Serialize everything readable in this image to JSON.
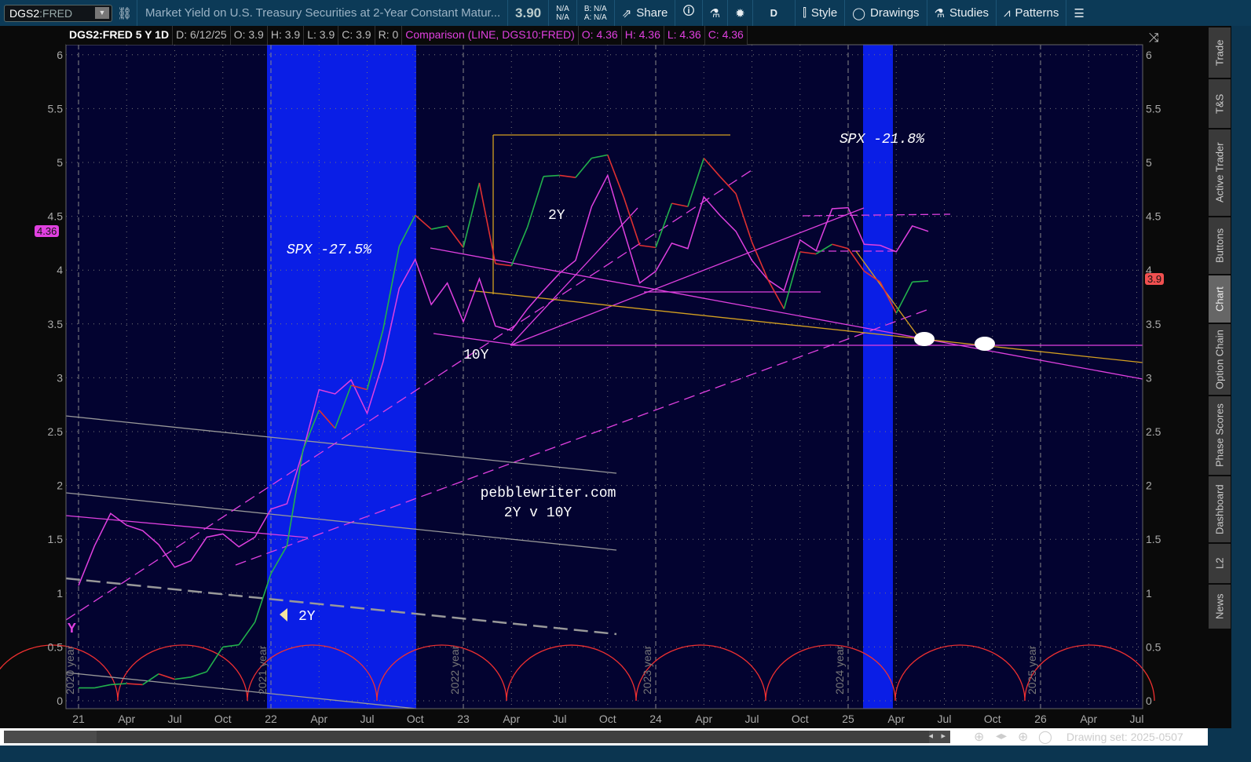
{
  "toolbar": {
    "symbol": "DGS2",
    "symbol_suffix": ":FRED",
    "description": "Market Yield on U.S. Treasury Securities at 2-Year Constant Matur...",
    "last": "3.90",
    "bidask_left": [
      "N/A",
      "N/A"
    ],
    "bid": "B: N/A",
    "ask": "A: N/A",
    "share": "Share",
    "period": "D",
    "style": "Style",
    "drawings": "Drawings",
    "studies": "Studies",
    "patterns": "Patterns"
  },
  "infobar": {
    "title": "DGS2:FRED 5 Y 1D",
    "date": "D: 6/12/25",
    "open": "O: 3.9",
    "high": "H: 3.9",
    "low": "L: 3.9",
    "close": "C: 3.9",
    "range": "R: 0",
    "comparison": "Comparison (LINE, DGS10:FRED)",
    "c_open": "O: 4.36",
    "c_high": "H: 4.36",
    "c_low": "L: 4.36",
    "c_close": "C: 4.36"
  },
  "bubbles": {
    "comparison": "4.36",
    "last": "3.9"
  },
  "colors": {
    "accent": "#e040e0",
    "up": "#22b14c",
    "down": "#e03030",
    "shade": "#0a1ee6",
    "bg": "#030330"
  },
  "annotations": {
    "spx1": "SPX -27.5%",
    "spx2": "SPX -21.8%",
    "lbl2y": "2Y",
    "lbl10y": "10Y",
    "site": "pebblewriter.com",
    "sub": "2Y v 10Y",
    "arrow2y": "2Y",
    "ylab": "Y"
  },
  "year_markers": [
    "2020 year",
    "2021 year",
    "2022 year",
    "2023 year",
    "2024 year",
    "2025 year"
  ],
  "side_tabs": [
    "Trade",
    "T&S",
    "Active Trader",
    "Buttons",
    "Chart",
    "Option Chain",
    "Phase Scores",
    "Dashboard",
    "L2",
    "News"
  ],
  "bottom": {
    "drawing_set": "Drawing set: 2025-0507"
  },
  "chart_data": {
    "type": "line",
    "title": "DGS2:FRED 5 Y 1D",
    "ylim": [
      0,
      6
    ],
    "yticks": [
      "0",
      "0.5",
      "1",
      "1.5",
      "2",
      "2.5",
      "3",
      "3.5",
      "4",
      "4.5",
      "5",
      "5.5",
      "6"
    ],
    "xticks": [
      "21",
      "Apr",
      "Jul",
      "Oct",
      "22",
      "Apr",
      "Jul",
      "Oct",
      "23",
      "Apr",
      "Jul",
      "Oct",
      "24",
      "Apr",
      "Jul",
      "Oct",
      "25",
      "Apr",
      "Jul",
      "Oct",
      "26",
      "Apr",
      "Jul"
    ],
    "x_start": "2021-01",
    "x_step": "month",
    "series": [
      {
        "name": "DGS2",
        "values": [
          0.12,
          0.12,
          0.15,
          0.16,
          0.15,
          0.25,
          0.2,
          0.22,
          0.27,
          0.5,
          0.52,
          0.73,
          1.18,
          1.44,
          2.33,
          2.7,
          2.53,
          2.93,
          2.89,
          3.45,
          4.22,
          4.51,
          4.38,
          4.41,
          4.21,
          4.81,
          4.06,
          4.04,
          4.4,
          4.87,
          4.88,
          4.86,
          5.04,
          5.07,
          4.68,
          4.23,
          4.21,
          4.62,
          4.59,
          5.04,
          4.87,
          4.71,
          4.26,
          3.91,
          3.64,
          4.17,
          4.15,
          4.24,
          4.2,
          3.99,
          3.89,
          3.6,
          3.89,
          3.9
        ]
      },
      {
        "name": "DGS10",
        "values": [
          1.07,
          1.44,
          1.74,
          1.63,
          1.58,
          1.45,
          1.24,
          1.3,
          1.52,
          1.55,
          1.43,
          1.52,
          1.78,
          1.83,
          2.32,
          2.89,
          2.85,
          2.98,
          2.67,
          3.15,
          3.83,
          4.1,
          3.68,
          3.88,
          3.52,
          3.92,
          3.48,
          3.44,
          3.64,
          3.81,
          3.97,
          4.09,
          4.59,
          4.88,
          4.37,
          3.88,
          3.99,
          4.25,
          4.2,
          4.68,
          4.51,
          4.36,
          4.09,
          3.91,
          3.81,
          4.28,
          4.18,
          4.57,
          4.58,
          4.24,
          4.23,
          4.17,
          4.41,
          4.36
        ]
      }
    ]
  }
}
